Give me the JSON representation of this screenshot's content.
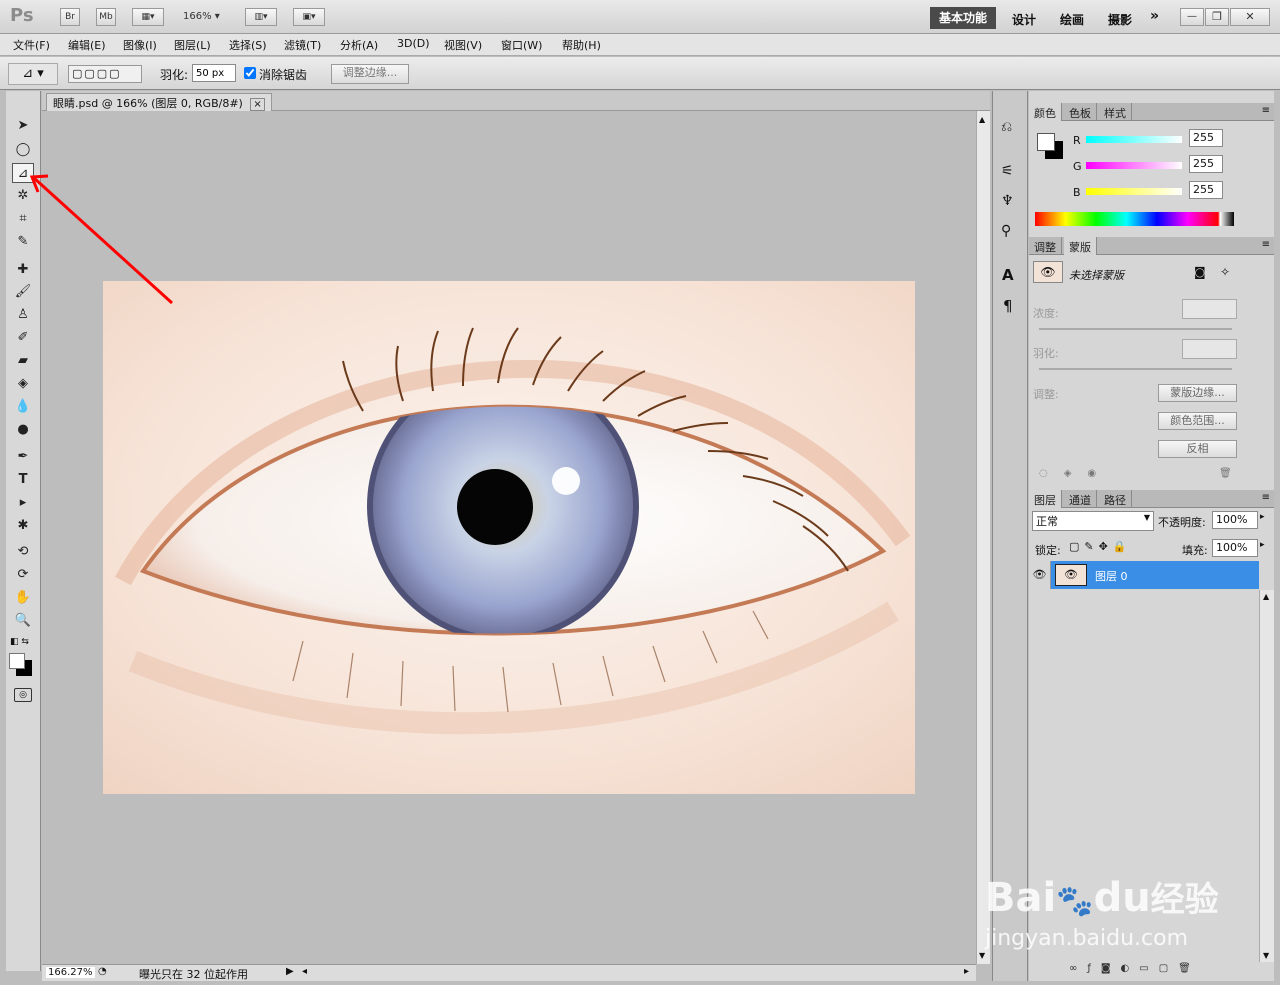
{
  "app": {
    "logo": "Ps",
    "br": "Br",
    "mb": "Mb",
    "zoom": "166%"
  },
  "workspaces": [
    "基本功能",
    "设计",
    "绘画",
    "摄影"
  ],
  "workspace_more": "»",
  "window_controls": [
    "—",
    "❐",
    "✕"
  ],
  "menu": [
    "文件(F)",
    "编辑(E)",
    "图像(I)",
    "图层(L)",
    "选择(S)",
    "滤镜(T)",
    "分析(A)",
    "3D(D)",
    "视图(V)",
    "窗口(W)",
    "帮助(H)"
  ],
  "options": {
    "feather_label": "羽化:",
    "feather_value": "50 px",
    "antialias_label": "消除锯齿",
    "antialias_checked": true,
    "refine_edge": "调整边缘..."
  },
  "document": {
    "tab_title": "眼睛.psd @ 166% (图层 0, RGB/8#)",
    "tab_close": "×"
  },
  "status": {
    "zoom": "166.27%",
    "message": "曝光只在 32 位起作用"
  },
  "color_panel": {
    "tabs": [
      "颜色",
      "色板",
      "样式"
    ],
    "r_label": "R",
    "g_label": "G",
    "b_label": "B",
    "r": "255",
    "g": "255",
    "b": "255"
  },
  "mask_panel": {
    "tabs": [
      "调整",
      "蒙版"
    ],
    "no_selection": "未选择蒙版",
    "density_label": "浓度:",
    "feather_label": "羽化:",
    "adjust_label": "调整:",
    "mask_edge": "蒙版边缘...",
    "color_range": "颜色范围...",
    "invert": "反相"
  },
  "layers_panel": {
    "tabs": [
      "图层",
      "通道",
      "路径"
    ],
    "blend_mode": "正常",
    "opacity_label": "不透明度:",
    "opacity": "100%",
    "lock_label": "锁定:",
    "fill_label": "填充:",
    "fill": "100%",
    "layers": [
      {
        "name": "图层 0",
        "visible": true,
        "selected": true
      }
    ]
  },
  "watermark": {
    "brand": "Bai",
    "brand2": "du",
    "brand_cn": "经验",
    "url": "jingyan.baidu.com"
  },
  "colors": {
    "accent": "#3a8ee6",
    "workspace_active": "#4a4a4a",
    "arrow": "#ff0000"
  }
}
